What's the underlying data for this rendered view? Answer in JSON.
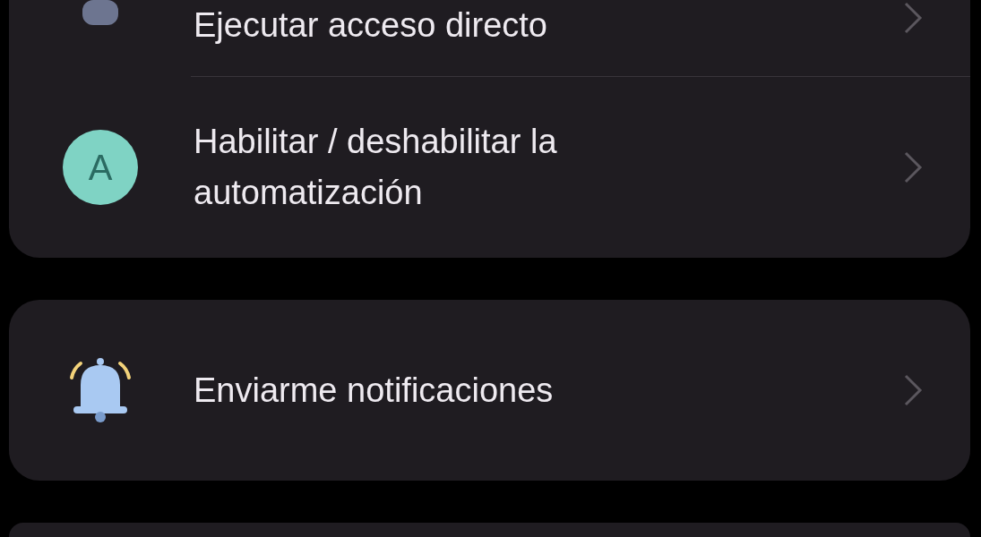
{
  "cards": [
    {
      "rows": [
        {
          "kind": "shortcut",
          "label": "Ejecutar acceso directo"
        },
        {
          "kind": "letter",
          "letter": "A",
          "label": "Habilitar / deshabilitar la automatización"
        }
      ]
    },
    {
      "rows": [
        {
          "kind": "bell",
          "label": "Enviarme notificaciones"
        }
      ]
    }
  ]
}
